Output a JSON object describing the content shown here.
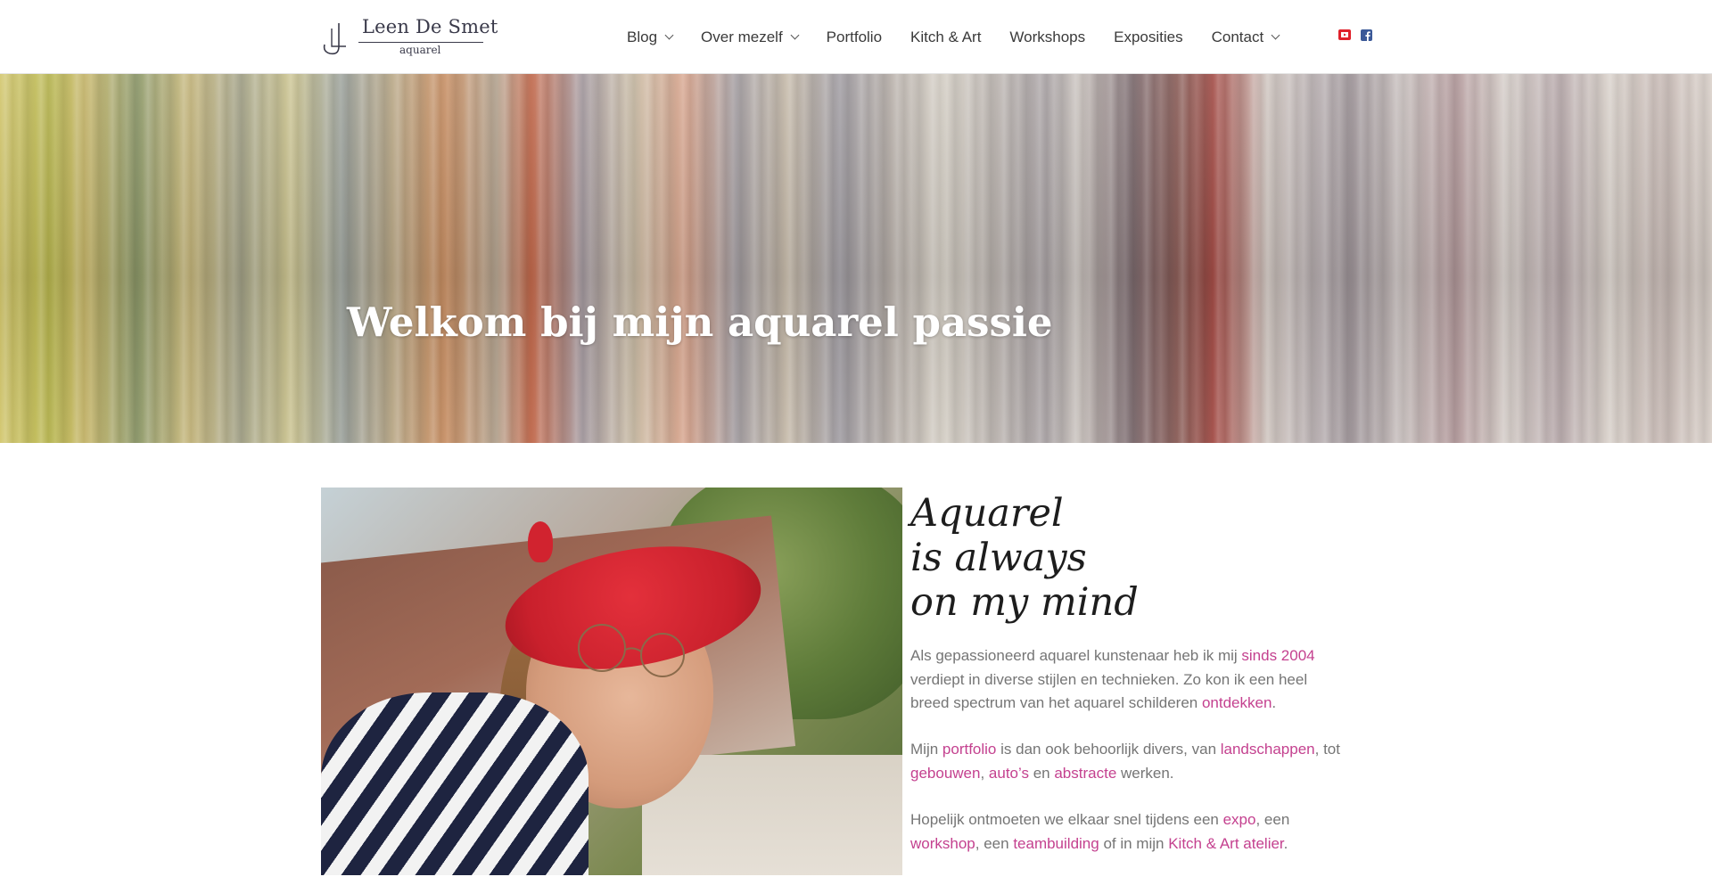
{
  "header": {
    "logo": {
      "name": "Leen De Smet",
      "subtitle": "aquarel"
    },
    "nav": [
      {
        "label": "Blog",
        "has_dropdown": true
      },
      {
        "label": "Over mezelf",
        "has_dropdown": true
      },
      {
        "label": "Portfolio",
        "has_dropdown": false
      },
      {
        "label": "Kitch & Art",
        "has_dropdown": false
      },
      {
        "label": "Workshops",
        "has_dropdown": false
      },
      {
        "label": "Exposities",
        "has_dropdown": false
      },
      {
        "label": "Contact",
        "has_dropdown": true
      }
    ],
    "social": [
      {
        "icon": "youtube-icon",
        "color": "#e0202a"
      },
      {
        "icon": "facebook-icon",
        "color": "#3b5998"
      }
    ]
  },
  "hero": {
    "title": "Welkom bij mijn aquarel passie"
  },
  "main": {
    "quote": [
      "Aquarel",
      "is always",
      "on my mind"
    ],
    "paragraph1": {
      "t1": "Als gepassioneerd aquarel kunstenaar heb ik mij ",
      "link1": "sinds 2004",
      "t2": " verdiept in diverse stijlen en technieken. Zo kon ik een heel breed spectrum van het aquarel schilderen ",
      "link2": "ontdekken",
      "t3": "."
    },
    "paragraph2": {
      "t1": "Mijn ",
      "link1": "portfolio",
      "t2": " is dan ook behoorlijk divers, van ",
      "link2": "landschappen",
      "t3": ", tot ",
      "link3": "gebouwen",
      "t4": ", ",
      "link4": "auto’s",
      "t5": " en ",
      "link5": "abstracte",
      "t6": " werken."
    },
    "paragraph3": {
      "t1": "Hopelijk ontmoeten we elkaar snel tijdens een ",
      "link1": "expo",
      "t2": ", een ",
      "link2": "workshop",
      "t3": ", een ",
      "link3": "teambuilding",
      "t4": " of in mijn ",
      "link4": "Kitch & Art atelier",
      "t5": "."
    }
  },
  "colors": {
    "link": "#c4418f",
    "body_text": "#757575",
    "nav_text": "#3a3a3a"
  }
}
